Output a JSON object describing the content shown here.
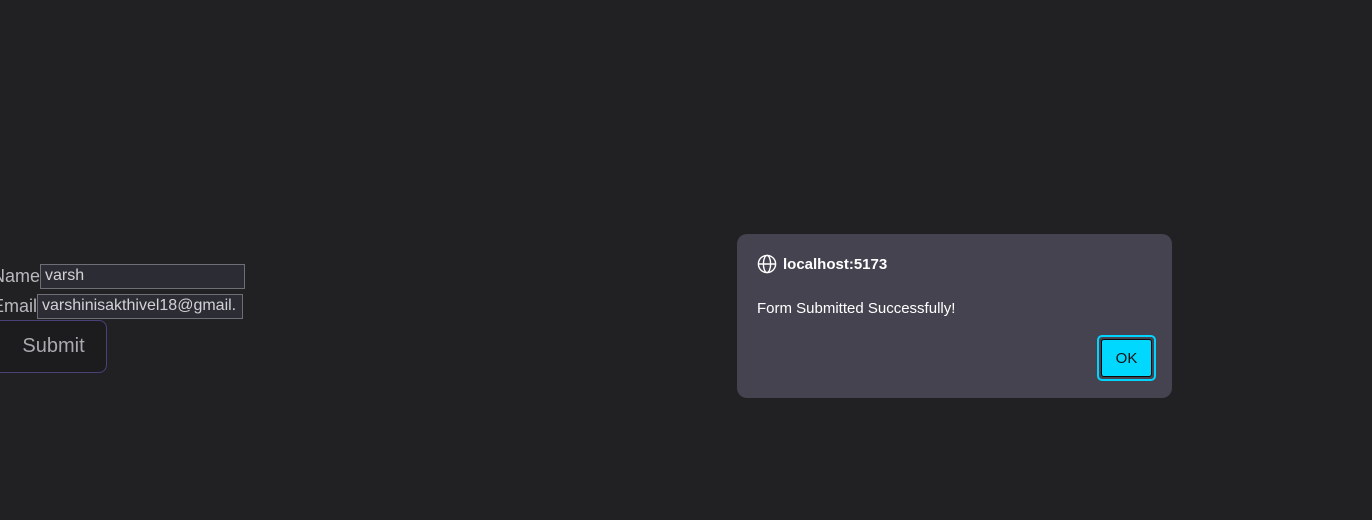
{
  "form": {
    "name_label": "Name",
    "name_value": "varsh",
    "email_label": "Email",
    "email_value": "varshinisakthivel18@gmail.",
    "submit_label": "Submit"
  },
  "dialog": {
    "icon": "globe-icon",
    "origin": "localhost:5173",
    "message": "Form Submitted Successfully!",
    "ok_label": "OK"
  },
  "colors": {
    "background": "#212123",
    "dialog_background": "#45434f",
    "accent": "#00d8ff",
    "submit_border": "#4a4178"
  }
}
